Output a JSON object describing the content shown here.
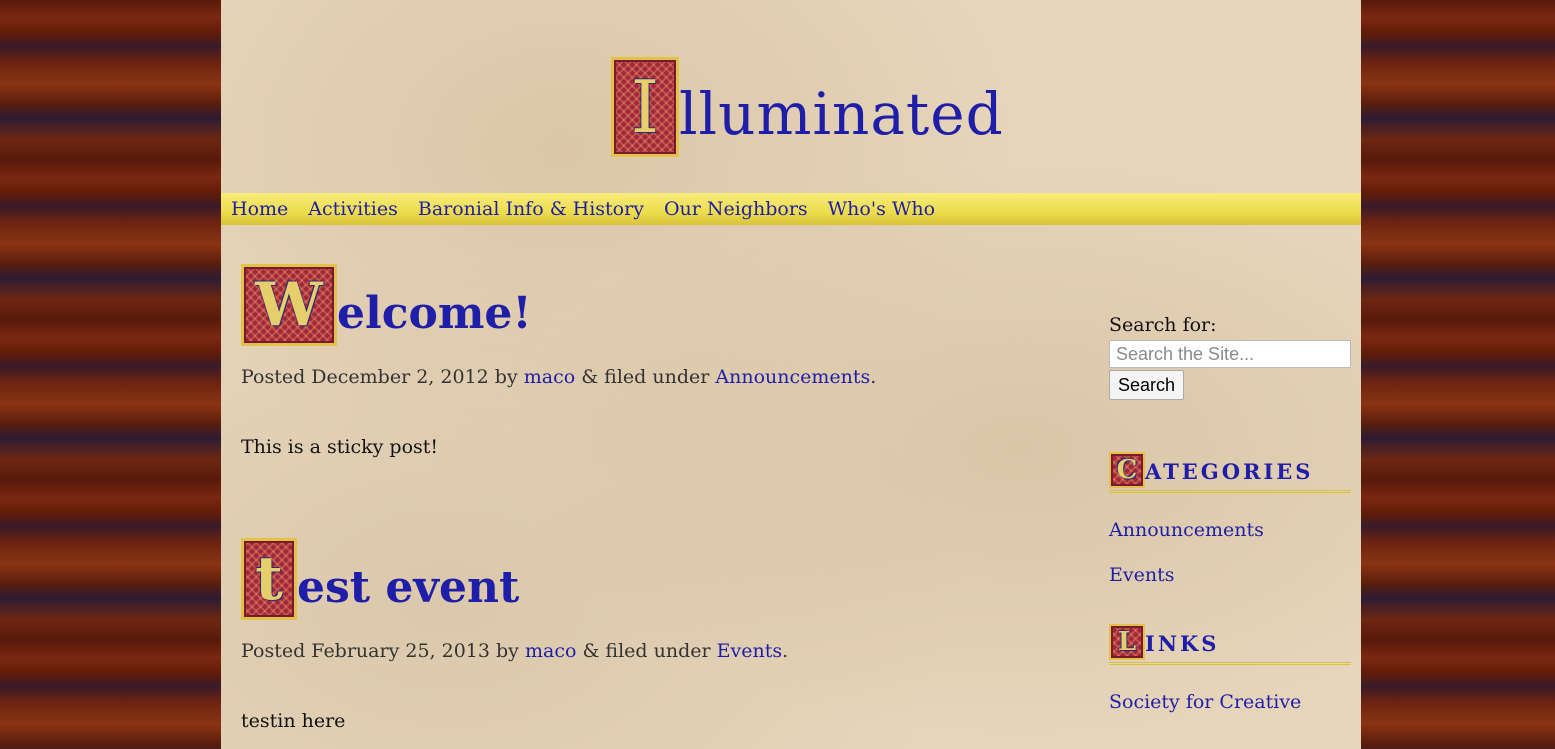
{
  "site": {
    "title_initial": "I",
    "title_rest": "lluminated"
  },
  "nav": {
    "items": [
      {
        "label": "Home"
      },
      {
        "label": "Activities"
      },
      {
        "label": "Baronial Info & History"
      },
      {
        "label": "Our Neighbors"
      },
      {
        "label": "Who's Who"
      }
    ]
  },
  "posts": [
    {
      "title_initial": "W",
      "title_rest": "elcome!",
      "posted_prefix": "Posted",
      "date": "December 2, 2012",
      "by": "by",
      "author": "maco",
      "filed_under": "& filed under",
      "category": "Announcements",
      "period": ".",
      "body": "This is a sticky post!"
    },
    {
      "title_initial": "t",
      "title_rest": "est event",
      "posted_prefix": "Posted",
      "date": "February 25, 2013",
      "by": "by",
      "author": "maco",
      "filed_under": "& filed under",
      "category": "Events",
      "period": ".",
      "body": "testin here"
    }
  ],
  "sidebar": {
    "search": {
      "label": "Search for:",
      "placeholder": "Search the Site...",
      "button_label": "Search"
    },
    "categories": {
      "title_initial": "C",
      "title_rest": "ategories",
      "items": [
        {
          "label": "Announcements"
        },
        {
          "label": "Events"
        }
      ]
    },
    "links": {
      "title_initial": "L",
      "title_rest": "inks",
      "items": [
        {
          "label": "Society for Creative"
        }
      ]
    }
  }
}
